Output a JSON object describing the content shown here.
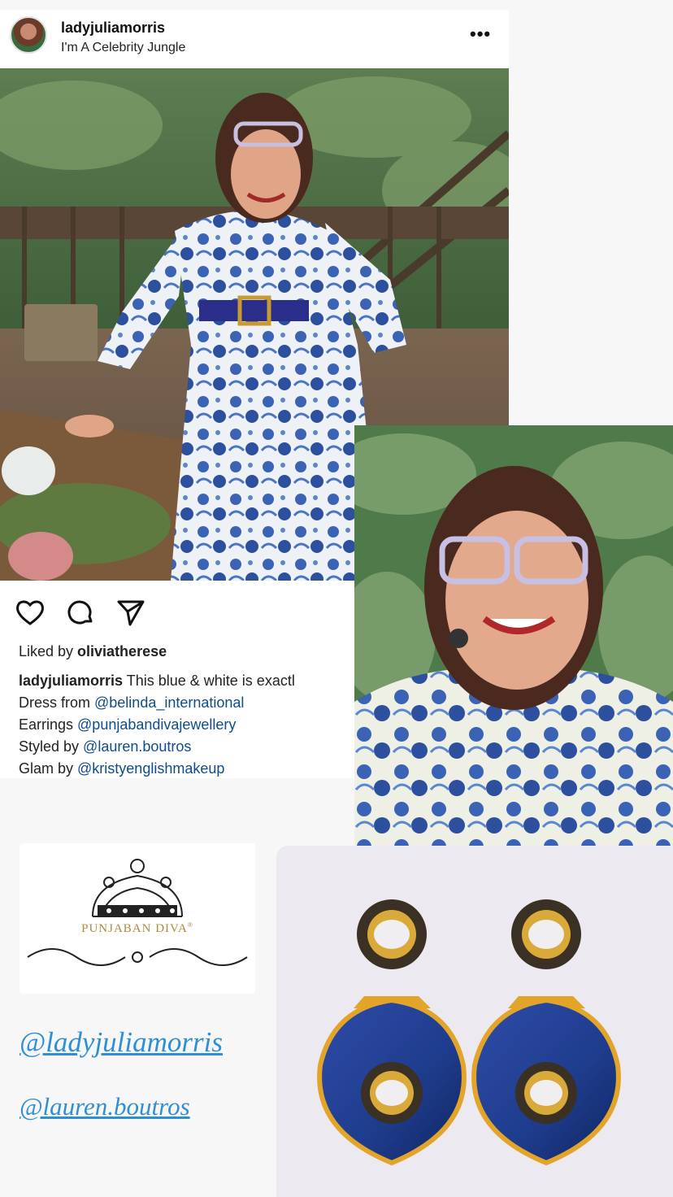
{
  "post": {
    "username": "ladyjuliamorris",
    "location": "I'm A Celebrity Jungle",
    "more_label": "•••",
    "liked_prefix": "Liked by ",
    "liked_user": "oliviatherese",
    "caption": {
      "user": "ladyjuliamorris",
      "text": " This blue & white is exactl",
      "lines": [
        {
          "prefix": "Dress from ",
          "mention": "@belinda_international"
        },
        {
          "prefix": "Earrings ",
          "mention": "@punjabandivajewellery"
        },
        {
          "prefix": "Styled by ",
          "mention": "@lauren.boutros"
        },
        {
          "prefix": "Glam by ",
          "mention": "@kristyenglishmakeup"
        }
      ]
    }
  },
  "brand": {
    "name": "PUNJABAN DIVA",
    "mark": "®"
  },
  "handles": [
    "@ladyjuliamorris",
    "@lauren.boutros"
  ],
  "colors": {
    "mention": "#0e4c8a",
    "handle": "#2f8fd6",
    "brand_gold": "#b08a3c",
    "sapphire": "#1e3c8c"
  }
}
